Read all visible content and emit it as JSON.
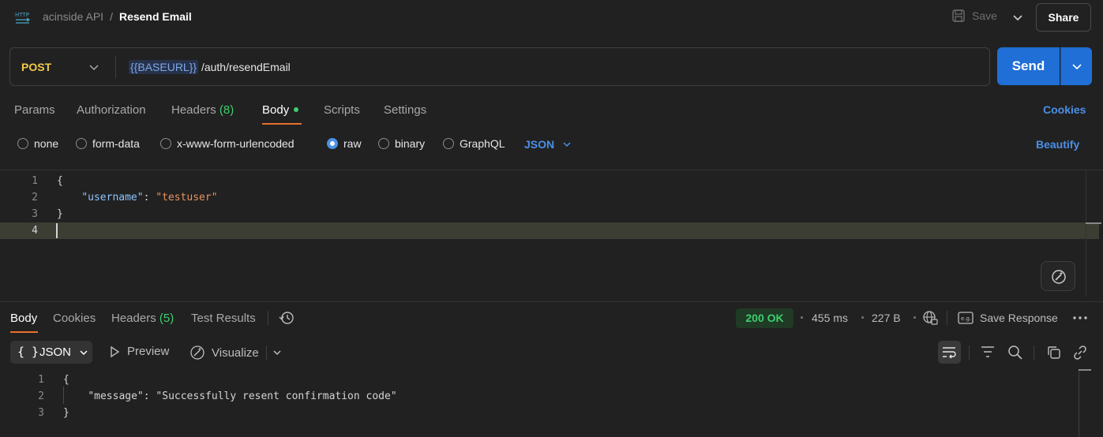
{
  "header": {
    "collection": "acinside API",
    "separator": "/",
    "request_name": "Resend Email",
    "save_label": "Save",
    "share_label": "Share"
  },
  "request": {
    "method": "POST",
    "url_variable": "{{BASEURL}}",
    "url_path": " /auth/resendEmail",
    "send_label": "Send"
  },
  "request_tabs": {
    "params": "Params",
    "authorization": "Authorization",
    "headers": "Headers",
    "headers_count": "(8)",
    "body": "Body",
    "scripts": "Scripts",
    "settings": "Settings",
    "cookies": "Cookies"
  },
  "body_types": {
    "none": "none",
    "form_data": "form-data",
    "urlencoded": "x-www-form-urlencoded",
    "raw": "raw",
    "binary": "binary",
    "graphql": "GraphQL",
    "selected": "raw",
    "format": "JSON",
    "beautify": "Beautify"
  },
  "editor": {
    "lines": [
      {
        "n": "1",
        "open": "{"
      },
      {
        "n": "2",
        "key": "\"username\"",
        "colon": ": ",
        "value": "\"testuser\""
      },
      {
        "n": "3",
        "close": "}"
      },
      {
        "n": "4"
      }
    ]
  },
  "response_tabs": {
    "body": "Body",
    "cookies": "Cookies",
    "headers": "Headers",
    "headers_count": "(5)",
    "test_results": "Test Results"
  },
  "response_meta": {
    "status": "200 OK",
    "time": "455 ms",
    "size": "227 B",
    "save_response": "Save Response"
  },
  "response_toolbar": {
    "format_brace": "{ }",
    "format": "JSON",
    "preview": "Preview",
    "visualize": "Visualize"
  },
  "response_body": {
    "lines": [
      {
        "n": "1",
        "open": "{"
      },
      {
        "n": "2",
        "key": "\"message\"",
        "colon": ": ",
        "value": "\"Successfully resent confirmation code\""
      },
      {
        "n": "3",
        "close": "}"
      }
    ]
  },
  "colors": {
    "accent": "#e8702e",
    "send_blue": "#1f6fd6",
    "link_blue": "#4a90e8",
    "success_green": "#3ecf6e",
    "method_yellow": "#f2c94c"
  }
}
